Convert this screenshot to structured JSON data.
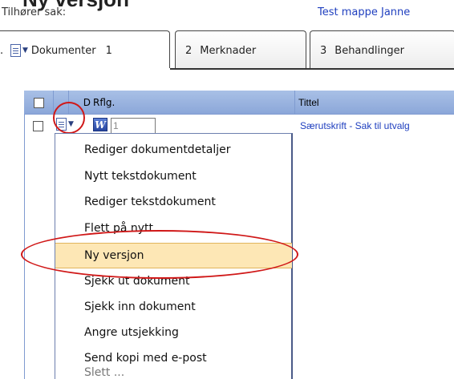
{
  "page": {
    "heading": "Ny versjon",
    "belongs_label": "Tilhører sak:",
    "case_link": "Test mappe Janne"
  },
  "tabs": [
    {
      "prefix": ".",
      "label": "Dokumenter",
      "number": "1"
    },
    {
      "number": "2",
      "label": "Merknader"
    },
    {
      "number": "3",
      "label": "Behandlinger"
    }
  ],
  "grid": {
    "headers": {
      "d": "D",
      "rflg": "Rflg.",
      "tittel": "Tittel"
    },
    "row": {
      "doc_type": "W",
      "rflg_value": "1",
      "title": "Særutskrift - Sak til utvalg"
    }
  },
  "menu": {
    "items": [
      "Rediger dokumentdetaljer",
      "Nytt tekstdokument",
      "Rediger tekstdokument",
      "Flett på nytt",
      "Ny versjon",
      "Sjekk ut dokument",
      "Sjekk inn dokument",
      "Angre utsjekking",
      "Send kopi med e-post",
      "Slett   ..."
    ],
    "active_index": 4
  },
  "annotations": {
    "color": "#d01818"
  },
  "icons": {
    "document": "document-icon",
    "dropdown": "chevron-down-icon",
    "word": "word-icon"
  }
}
